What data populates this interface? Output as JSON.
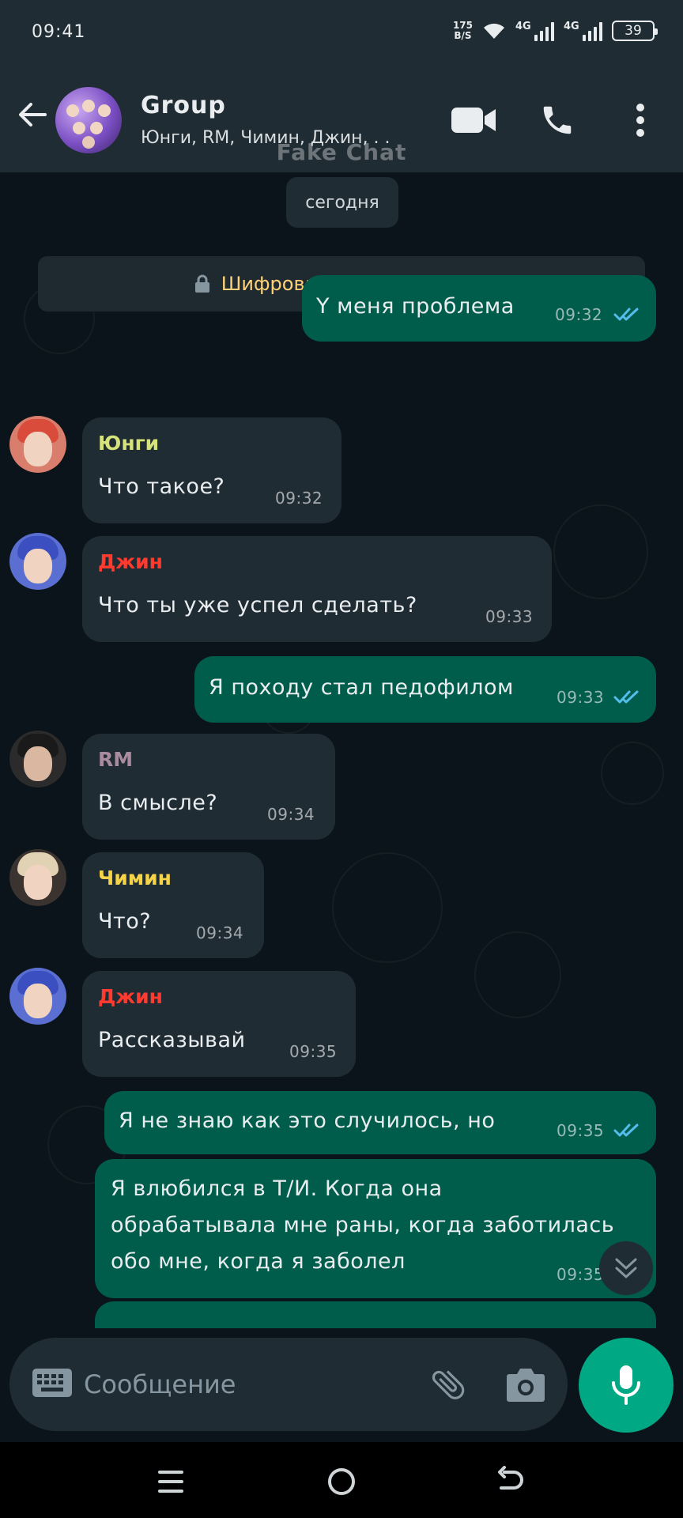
{
  "status_bar": {
    "time": "09:41",
    "net_speed_value": "175",
    "net_speed_unit": "B/S",
    "signal1_label": "4G",
    "signal2_label": "4G",
    "battery": "39"
  },
  "header": {
    "title": "Group",
    "members": "Юнги, RM, Чимин, Джин, . .",
    "watermark": "Fake Chat",
    "icons": [
      "back-arrow-icon",
      "video-call-icon",
      "phone-icon",
      "more-vert-icon"
    ]
  },
  "chat": {
    "date_label": "сегодня",
    "encryption_text": "Шифрование текста здесь",
    "messages": [
      {
        "dir": "out",
        "text": "Y меня проблема",
        "time": "09:32",
        "read": true
      },
      {
        "dir": "in",
        "sender": "Юнги",
        "sender_color": "#d6e27a",
        "text": "Что такое?",
        "time": "09:32"
      },
      {
        "dir": "in",
        "sender": "Джин",
        "sender_color": "#ff3b30",
        "text": "Что ты уже успел сделать?",
        "time": "09:33"
      },
      {
        "dir": "out",
        "text": "Я походу стал педофилом",
        "time": "09:33",
        "read": true
      },
      {
        "dir": "in",
        "sender": "RM",
        "sender_color": "#a98a9f",
        "text": "В смысле?",
        "time": "09:34"
      },
      {
        "dir": "in",
        "sender": "Чимин",
        "sender_color": "#f5d547",
        "text": "Что?",
        "time": "09:34"
      },
      {
        "dir": "in",
        "sender": "Джин",
        "sender_color": "#ff3b30",
        "text": "Рассказывай",
        "time": "09:35"
      },
      {
        "dir": "out",
        "text": "Я не знаю как это случилось, но",
        "time": "09:35",
        "read": true
      },
      {
        "dir": "out",
        "lines": [
          "Я влюбился в Т/И. Когда она",
          "обрабатывала мне раны, когда заботилась",
          "обо мне, когда я заболел"
        ],
        "time": "09:35"
      }
    ]
  },
  "input": {
    "placeholder": "Сообщение"
  },
  "colors": {
    "accent": "#00a884",
    "outgoing_bubble": "#005c4b",
    "incoming_bubble": "#202c33",
    "read_ticks": "#53bdeb",
    "header_bg": "#202c33",
    "chat_bg": "#0b141a"
  }
}
